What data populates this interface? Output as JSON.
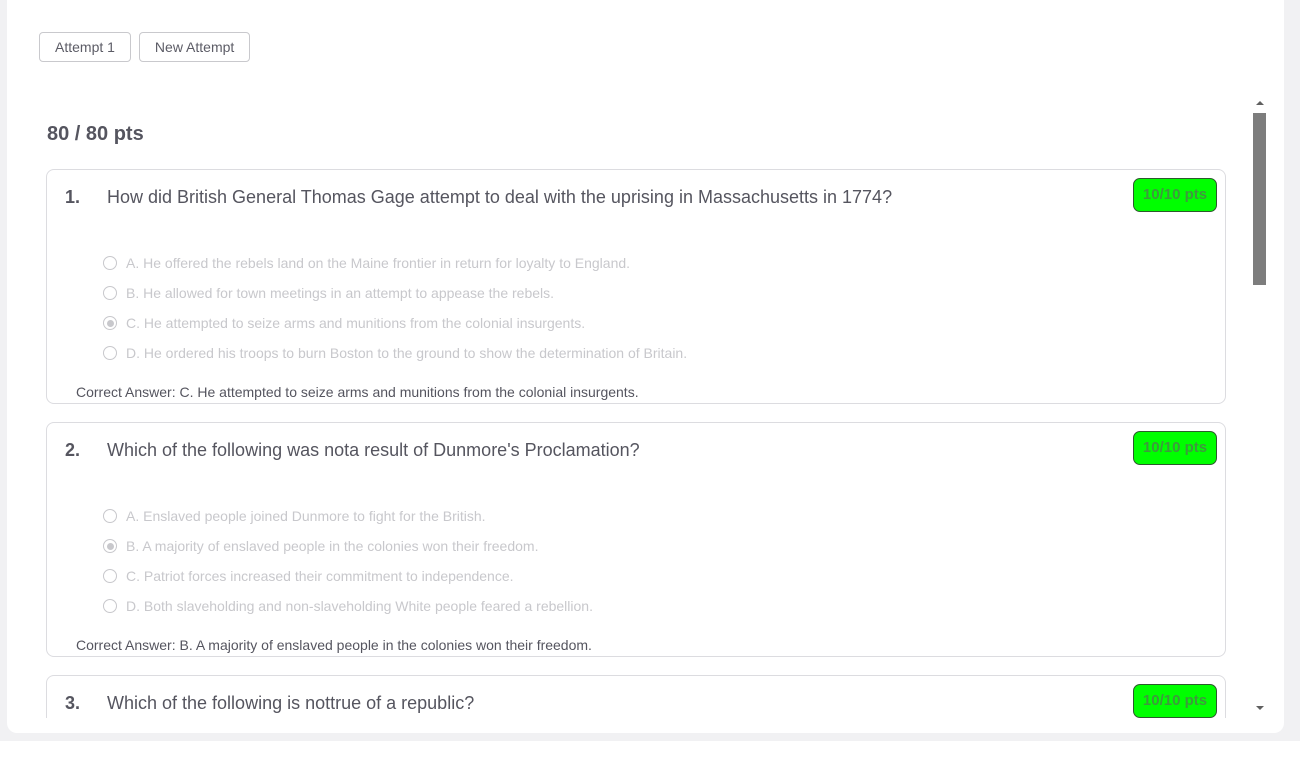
{
  "attempts": {
    "attempt_1_label": "Attempt 1",
    "new_attempt_label": "New Attempt"
  },
  "score": {
    "total": "80 / 80 pts"
  },
  "colors": {
    "badge_green": "#00ff00",
    "text_main": "#55555f",
    "text_disabled": "#c8c8cc"
  },
  "questions": [
    {
      "number": "1.",
      "text": "How did British General Thomas Gage attempt to deal with the uprising in Massachusetts in 1774?",
      "points": "10/10 pts",
      "selected_index": 2,
      "options": [
        "A. He offered the rebels land on the Maine frontier in return for loyalty to England.",
        "B. He allowed for town meetings in an attempt to appease the rebels.",
        "C. He attempted to seize arms and munitions from the colonial insurgents.",
        "D. He ordered his troops to burn Boston to the ground to show the determination of Britain."
      ],
      "correct_answer": "Correct Answer: C. He attempted to seize arms and munitions from the colonial insurgents."
    },
    {
      "number": "2.",
      "text": "Which of the following was nota result of Dunmore's Proclamation?",
      "points": "10/10 pts",
      "selected_index": 1,
      "options": [
        "A. Enslaved people joined Dunmore to fight for the British.",
        "B. A majority of enslaved people in the colonies won their freedom.",
        "C. Patriot forces increased their commitment to independence.",
        "D. Both slaveholding and non-slaveholding White people feared a rebellion."
      ],
      "correct_answer": "Correct Answer: B. A majority of enslaved people in the colonies won their freedom."
    },
    {
      "number": "3.",
      "text": "Which of the following is nottrue of a republic?",
      "points": "10/10 pts"
    }
  ]
}
